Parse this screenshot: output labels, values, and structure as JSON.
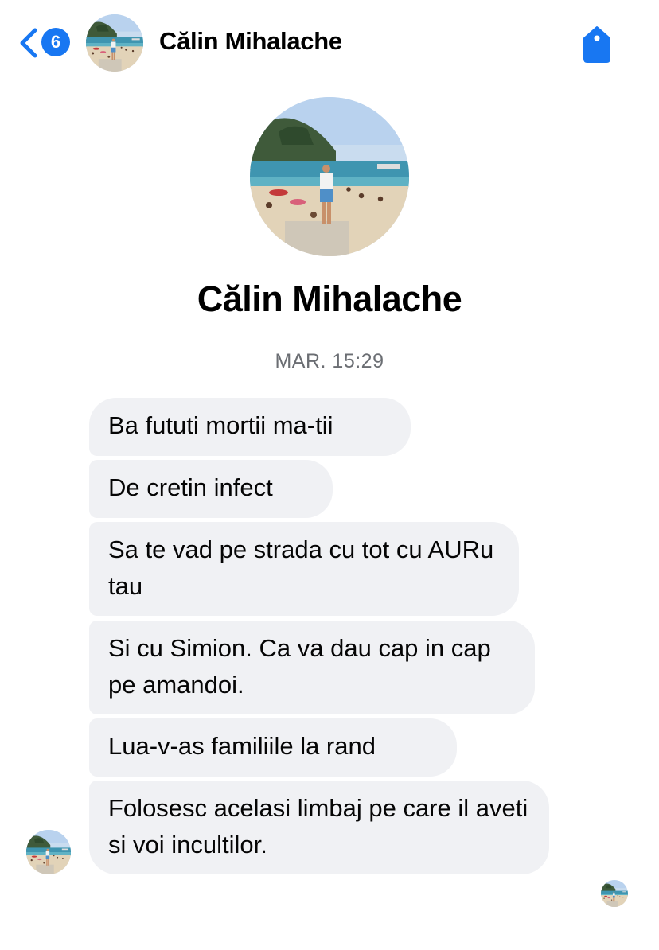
{
  "header": {
    "back_icon": "chevron-left-icon",
    "unread_count": "6",
    "contact_name": "Călin Mihalache",
    "action_icon": "tag-icon"
  },
  "profile": {
    "name": "Călin Mihalache"
  },
  "conversation": {
    "timestamp": "MAR. 15:29",
    "messages": [
      {
        "text": "Ba fututi mortii ma-tii"
      },
      {
        "text": "De cretin infect"
      },
      {
        "text": "Sa te vad pe strada cu tot cu AURu tau"
      },
      {
        "text": "Si cu Simion. Ca va dau cap in cap pe amandoi."
      },
      {
        "text": "Lua-v-as familiile la rand"
      },
      {
        "text": "Folosesc acelasi limbaj pe care il aveti si voi incultilor."
      }
    ]
  },
  "colors": {
    "accent": "#1877f2",
    "bubble_bg": "#f0f1f4",
    "timestamp": "#6b6e73"
  }
}
